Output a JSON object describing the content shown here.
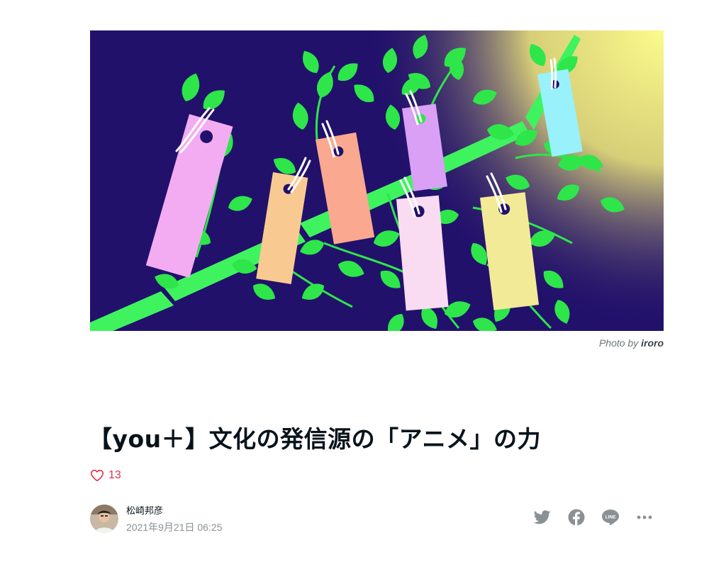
{
  "hero": {
    "credit_prefix": "Photo by",
    "credit_name": "iroro",
    "colors": {
      "sky": "#22116b",
      "glow": "#fbf98a",
      "bamboo": "#3ff35f",
      "leaf": "#2ee64a"
    },
    "tanzaku_colors": [
      "#f3acf2",
      "#f8ca92",
      "#faa88f",
      "#d9a0f6",
      "#f9dcf2",
      "#f3ea98",
      "#98f1fb"
    ]
  },
  "article": {
    "title": "【you＋】文化の発信源の「アニメ」の力",
    "like_count": "13",
    "like_icon": "heart-outline-icon"
  },
  "author": {
    "name": "松崎邦彦",
    "date": "2021年9月21日 06:25"
  },
  "share": {
    "icons": [
      "twitter-icon",
      "facebook-icon",
      "line-icon",
      "more-icon"
    ],
    "color": "#8a9196"
  },
  "accent_color": "#e0314b"
}
